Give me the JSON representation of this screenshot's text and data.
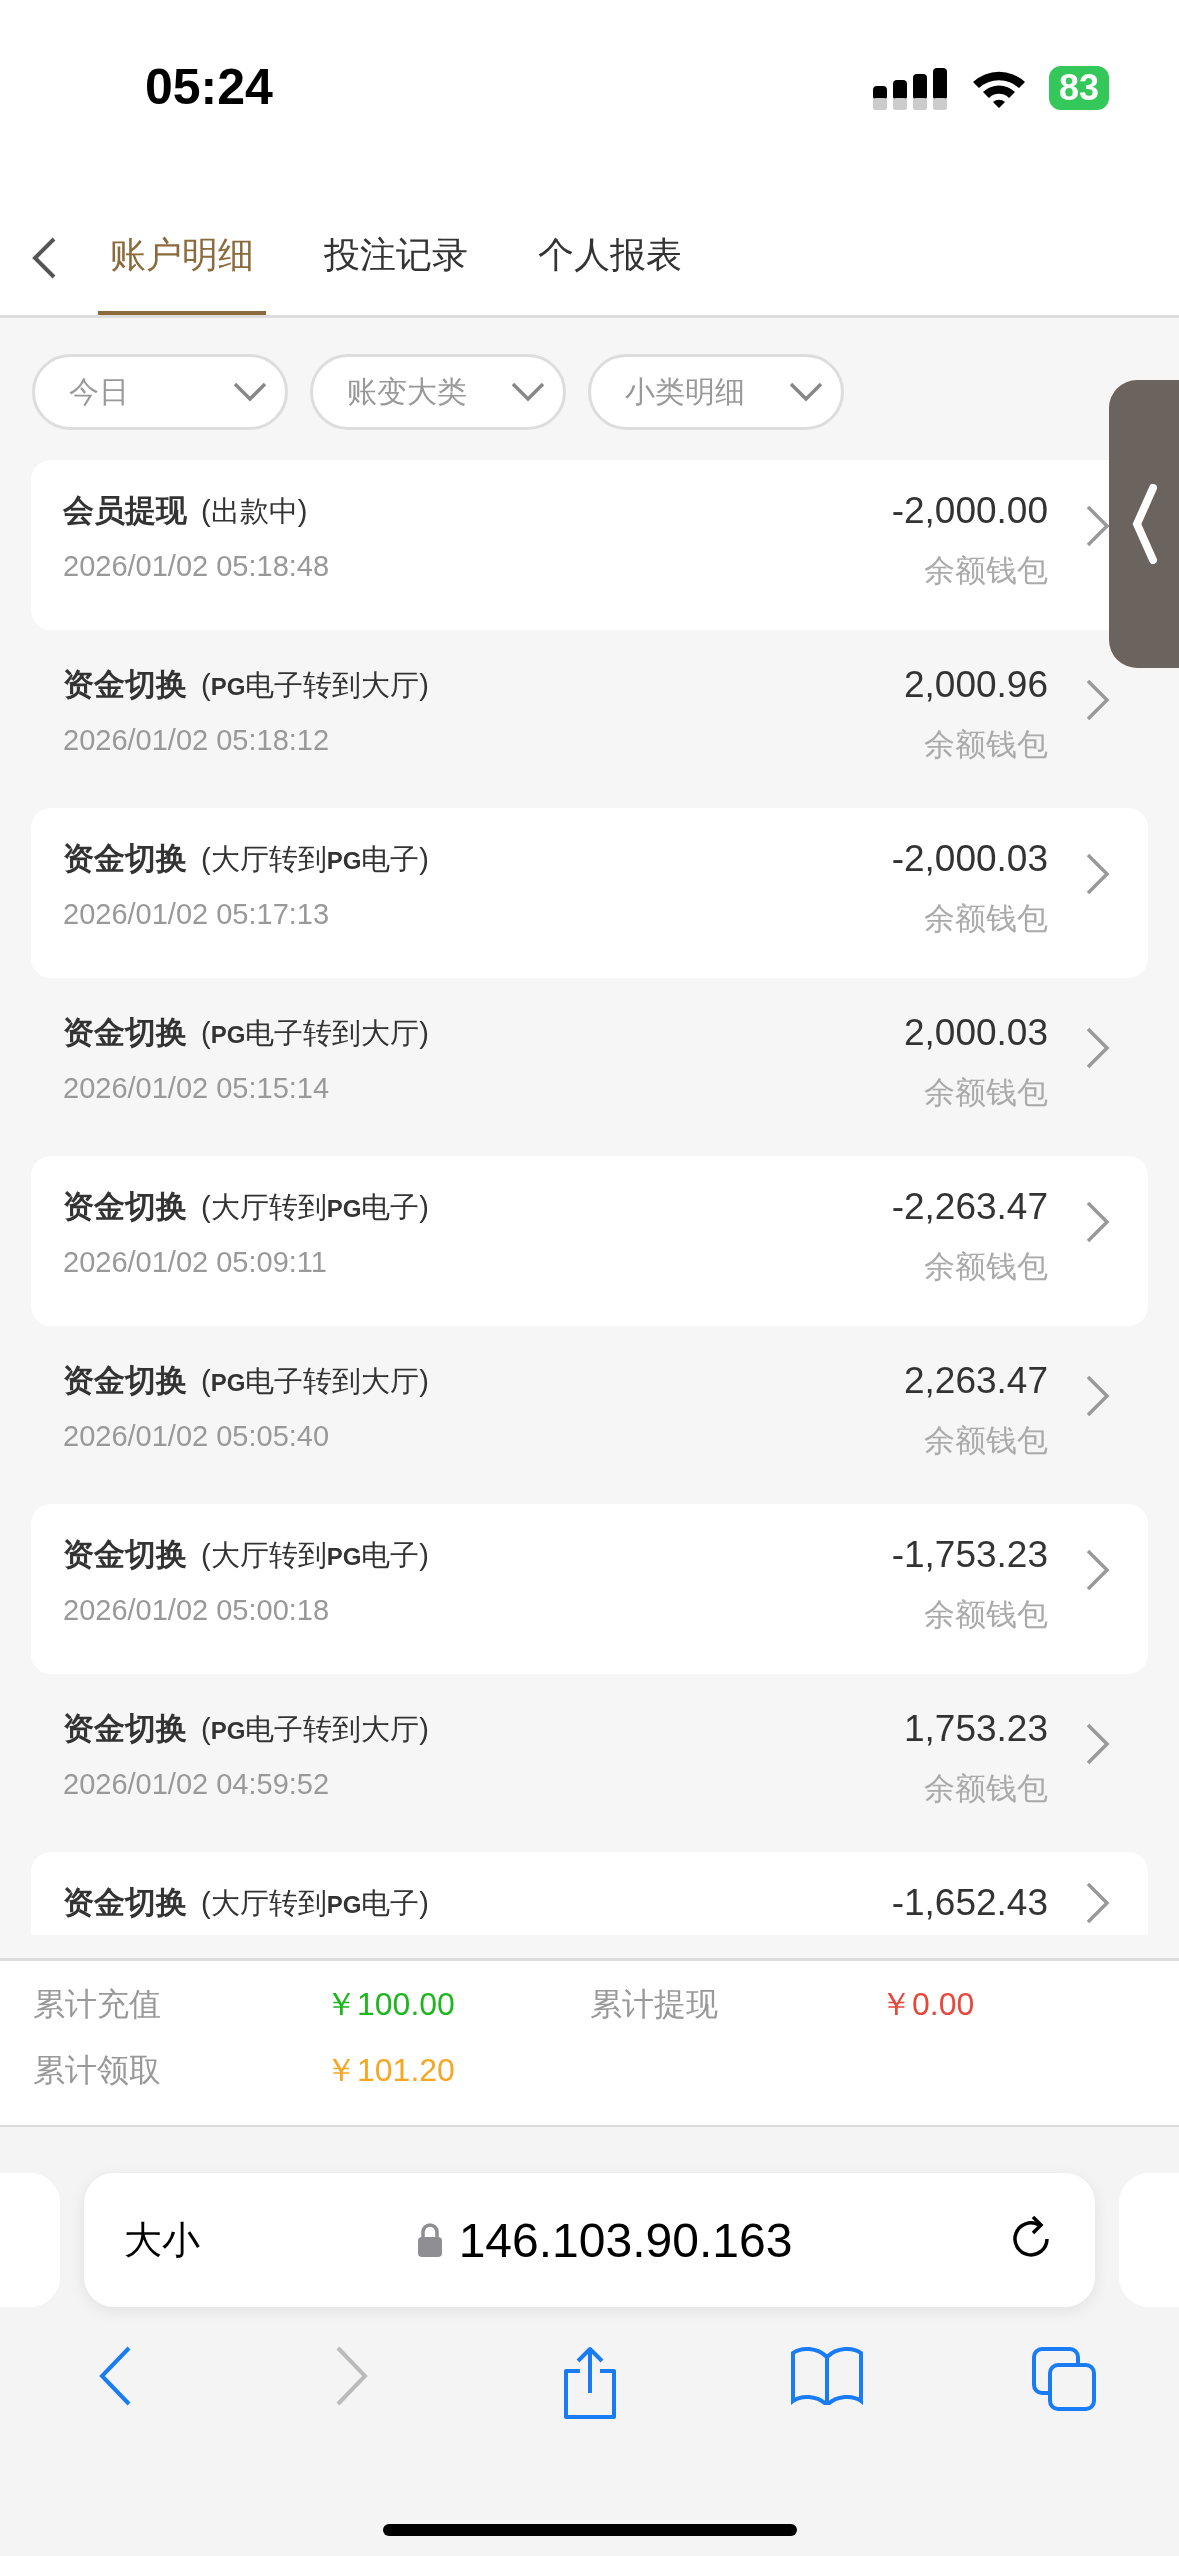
{
  "status_bar": {
    "time": "05:24",
    "battery": "83"
  },
  "tabs": [
    {
      "label": "账户明细",
      "selected": true
    },
    {
      "label": "投注记录",
      "selected": false
    },
    {
      "label": "个人报表",
      "selected": false
    }
  ],
  "filters": [
    {
      "label": "今日"
    },
    {
      "label": "账变大类"
    },
    {
      "label": "小类明细"
    }
  ],
  "records": [
    {
      "title": "会员提现",
      "note": "(出款中)",
      "amount": "-2,000.00",
      "date": "2026/01/02 05:18:48",
      "wallet": "余额钱包"
    },
    {
      "title": "资金切换",
      "note": "(**PG**电子转到大厅)",
      "amount": "2,000.96",
      "date": "2026/01/02 05:18:12",
      "wallet": "余额钱包"
    },
    {
      "title": "资金切换",
      "note": "(大厅转到**PG**电子)",
      "amount": "-2,000.03",
      "date": "2026/01/02 05:17:13",
      "wallet": "余额钱包"
    },
    {
      "title": "资金切换",
      "note": "(**PG**电子转到大厅)",
      "amount": "2,000.03",
      "date": "2026/01/02 05:15:14",
      "wallet": "余额钱包"
    },
    {
      "title": "资金切换",
      "note": "(大厅转到**PG**电子)",
      "amount": "-2,263.47",
      "date": "2026/01/02 05:09:11",
      "wallet": "余额钱包"
    },
    {
      "title": "资金切换",
      "note": "(**PG**电子转到大厅)",
      "amount": "2,263.47",
      "date": "2026/01/02 05:05:40",
      "wallet": "余额钱包"
    },
    {
      "title": "资金切换",
      "note": "(大厅转到**PG**电子)",
      "amount": "-1,753.23",
      "date": "2026/01/02 05:00:18",
      "wallet": "余额钱包"
    },
    {
      "title": "资金切换",
      "note": "(**PG**电子转到大厅)",
      "amount": "1,753.23",
      "date": "2026/01/02 04:59:52",
      "wallet": "余额钱包"
    },
    {
      "title": "资金切换",
      "note": "(大厅转到**PG**电子)",
      "amount": "-1,652.43"
    }
  ],
  "summary": [
    {
      "label": "累计充值",
      "value": "￥100.00",
      "color": "#1fb51f"
    },
    {
      "label": "累计提现",
      "value": "￥0.00",
      "color": "#e8473b"
    },
    {
      "label": "累计领取",
      "value": "￥101.20",
      "color": "#f5a623"
    }
  ],
  "browser": {
    "text_size": "大小",
    "url": "146.103.90.163"
  }
}
